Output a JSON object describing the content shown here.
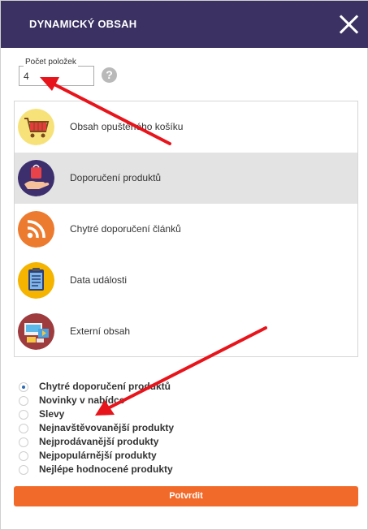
{
  "header": {
    "title": "DYNAMICKÝ OBSAH",
    "close_icon": "close-icon"
  },
  "count": {
    "label": "Počet položek",
    "value": "4",
    "help_icon": "question-circle-icon",
    "help_glyph": "?"
  },
  "content_types": [
    {
      "label": "Obsah opuštěného košíku",
      "icon": "shopping-cart-icon",
      "selected": false
    },
    {
      "label": "Doporučení produktů",
      "icon": "gift-hand-icon",
      "selected": true
    },
    {
      "label": "Chytré doporučení článků",
      "icon": "rss-icon",
      "selected": false
    },
    {
      "label": "Data události",
      "icon": "clipboard-icon",
      "selected": false
    },
    {
      "label": "Externí obsah",
      "icon": "external-content-icon",
      "selected": false
    }
  ],
  "options": [
    {
      "label": "Chytré doporučení produktů",
      "checked": true
    },
    {
      "label": "Novinky v nabídce",
      "checked": false
    },
    {
      "label": "Slevy",
      "checked": false
    },
    {
      "label": "Nejnavštěvovanější produkty",
      "checked": false
    },
    {
      "label": "Nejprodávanější produkty",
      "checked": false
    },
    {
      "label": "Nejpopulárnější produkty",
      "checked": false
    },
    {
      "label": "Nejlépe hodnocené produkty",
      "checked": false
    }
  ],
  "confirm_label": "Potvrdit",
  "colors": {
    "header": "#3b3163",
    "accent": "#f26a2a",
    "annotation": "#e8141b"
  }
}
